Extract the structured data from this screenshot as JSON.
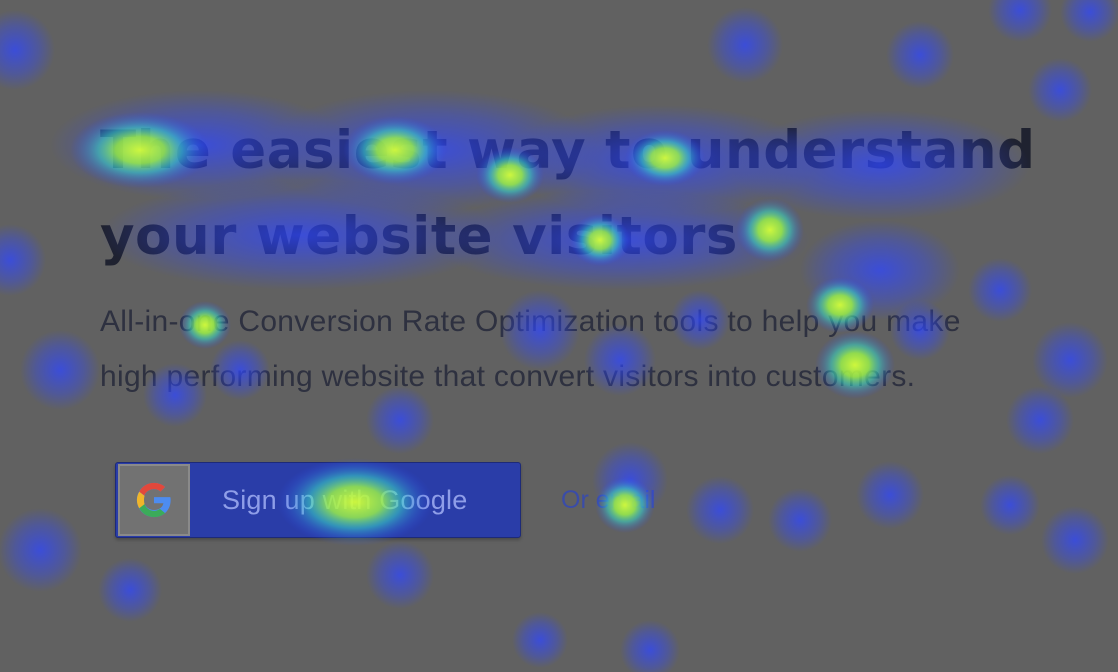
{
  "hero": {
    "headline_line1": "The easiest way to understand",
    "headline_line2": "your website visitors",
    "subtitle_line1": "All-in-one Conversion Rate Optimization tools to help you make",
    "subtitle_line2": "high performing website that convert visitors into customers."
  },
  "cta": {
    "google_button_label": "Sign up with Google",
    "google_icon": "google-g-icon",
    "email_link_label": "Or email"
  },
  "overlay": {
    "type": "attention-heatmap",
    "colors": {
      "low": "#2f47ff",
      "mid": "#37d6c0",
      "high": "#c8ff3c",
      "dim_background": "#616161"
    }
  }
}
